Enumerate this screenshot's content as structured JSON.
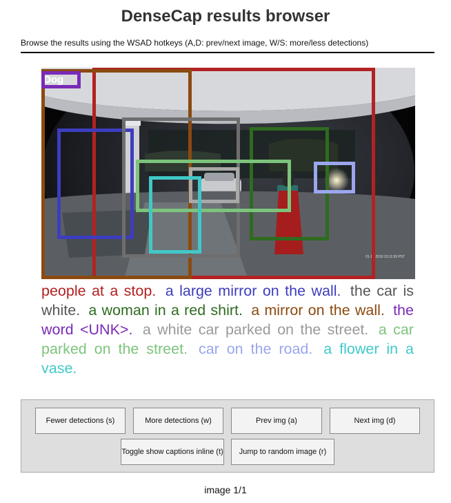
{
  "page": {
    "title": "DenseCap results browser",
    "subtitle": "Browse the results using the WSAD hotkeys (A,D: prev/next image, W/S: more/less detections)",
    "status": "image 1/1"
  },
  "image": {
    "timestamp_overlay": "01-12-2019 23:11:59 PST",
    "corner_text": "Dog"
  },
  "captions": [
    {
      "text": "people at a stop.",
      "color": "#b22222"
    },
    {
      "text": "a large mirror on the wall.",
      "color": "#3d3dbf"
    },
    {
      "text": "the car is white.",
      "color": "#555555"
    },
    {
      "text": "a woman in a red shirt.",
      "color": "#2e6b1f"
    },
    {
      "text": "a mirror on the wall.",
      "color": "#8b4a10"
    },
    {
      "text": "the word <UNK>.",
      "color": "#7a2ab8"
    },
    {
      "text": "a white car parked on the street.",
      "color": "#9a9a9a"
    },
    {
      "text": "a car parked on the street.",
      "color": "#7cc47c"
    },
    {
      "text": "car on the road.",
      "color": "#9aa6ee"
    },
    {
      "text": "a flower in a vase.",
      "color": "#40c8c8"
    }
  ],
  "controls": {
    "fewer": "Fewer detections (s)",
    "more": "More detections (w)",
    "prev": "Prev img (a)",
    "next": "Next img (d)",
    "toggle": "Toggle show captions inline (t)",
    "random": "Jump to random image (r)"
  }
}
